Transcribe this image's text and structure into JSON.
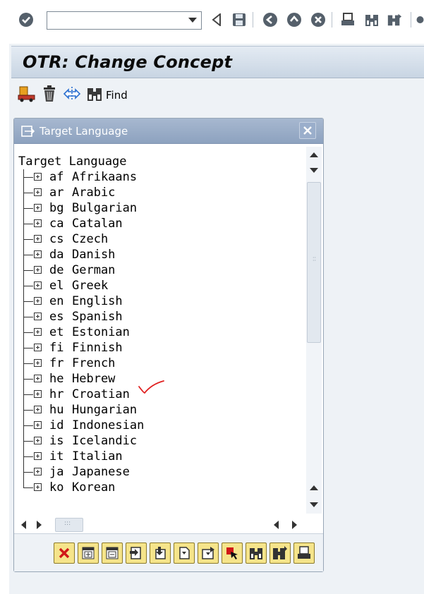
{
  "system_toolbar": {
    "command_field_value": "",
    "icons": [
      "enter-icon",
      "back-icon",
      "save-icon",
      "exit-icon",
      "logoff-icon",
      "cancel-icon",
      "print-icon",
      "find-icon",
      "find-next-icon"
    ]
  },
  "page": {
    "title": "OTR: Change Concept",
    "toolbar": {
      "find_label": "Find"
    }
  },
  "dialog": {
    "title": "Target Language",
    "tree": {
      "root_label": "Target Language",
      "items": [
        {
          "code": "af",
          "name": "Afrikaans"
        },
        {
          "code": "ar",
          "name": "Arabic"
        },
        {
          "code": "bg",
          "name": "Bulgarian"
        },
        {
          "code": "ca",
          "name": "Catalan"
        },
        {
          "code": "cs",
          "name": "Czech"
        },
        {
          "code": "da",
          "name": "Danish"
        },
        {
          "code": "de",
          "name": "German"
        },
        {
          "code": "el",
          "name": "Greek"
        },
        {
          "code": "en",
          "name": "English"
        },
        {
          "code": "es",
          "name": "Spanish"
        },
        {
          "code": "et",
          "name": "Estonian"
        },
        {
          "code": "fi",
          "name": "Finnish"
        },
        {
          "code": "fr",
          "name": "French"
        },
        {
          "code": "he",
          "name": "Hebrew"
        },
        {
          "code": "hr",
          "name": "Croatian"
        },
        {
          "code": "hu",
          "name": "Hungarian"
        },
        {
          "code": "id",
          "name": "Indonesian"
        },
        {
          "code": "is",
          "name": "Icelandic"
        },
        {
          "code": "it",
          "name": "Italian"
        },
        {
          "code": "ja",
          "name": "Japanese"
        },
        {
          "code": "ko",
          "name": "Korean"
        }
      ]
    },
    "footer_buttons": [
      "cancel-icon",
      "expand-icon",
      "collapse-icon",
      "expand-subtree-icon",
      "collapse-subtree-icon",
      "first-icon",
      "last-icon",
      "select-icon",
      "find-icon",
      "find-next-icon",
      "print-icon"
    ]
  },
  "colors": {
    "title_bar": "#c8d5e3",
    "dialog_header": "#8da2bf",
    "footer_button": "#f5e48a",
    "annotation_check": "#e02020"
  }
}
